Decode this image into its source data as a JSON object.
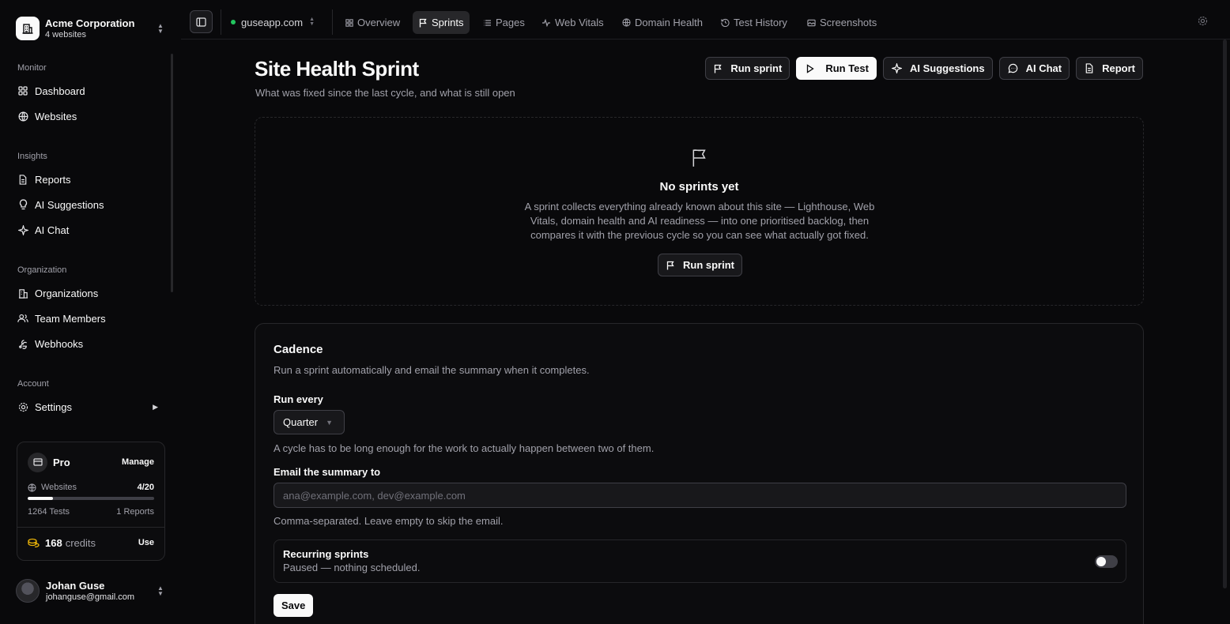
{
  "org": {
    "name": "Acme Corporation",
    "subtitle": "4 websites"
  },
  "sidebar": {
    "groups": [
      {
        "title": "Monitor",
        "items": [
          {
            "label": "Dashboard",
            "icon": "grid-icon"
          },
          {
            "label": "Websites",
            "icon": "globe-icon"
          }
        ]
      },
      {
        "title": "Insights",
        "items": [
          {
            "label": "Reports",
            "icon": "file-icon"
          },
          {
            "label": "AI Suggestions",
            "icon": "lightbulb-icon"
          },
          {
            "label": "AI Chat",
            "icon": "sparkles-icon"
          }
        ]
      },
      {
        "title": "Organization",
        "items": [
          {
            "label": "Organizations",
            "icon": "building-icon"
          },
          {
            "label": "Team Members",
            "icon": "users-icon"
          },
          {
            "label": "Webhooks",
            "icon": "webhook-icon"
          }
        ]
      },
      {
        "title": "Account",
        "items": [
          {
            "label": "Settings",
            "icon": "gear-icon"
          }
        ]
      }
    ]
  },
  "plan": {
    "name": "Pro",
    "manage_label": "Manage",
    "websites_label": "Websites",
    "websites_value": "4/20",
    "websites_fraction": 0.2,
    "tests": "1264 Tests",
    "reports": "1 Reports",
    "credits_value": "168",
    "credits_label": "credits",
    "use_label": "Use"
  },
  "user": {
    "name": "Johan Guse",
    "email": "johanguse@gmail.com"
  },
  "topbar": {
    "site": "guseapp.com",
    "tabs": [
      {
        "label": "Overview",
        "icon": "grid-icon"
      },
      {
        "label": "Sprints",
        "icon": "flag-icon",
        "active": true
      },
      {
        "label": "Pages",
        "icon": "list-icon"
      },
      {
        "label": "Web Vitals",
        "icon": "activity-icon"
      },
      {
        "label": "Domain Health",
        "icon": "globe-icon"
      },
      {
        "label": "Test History",
        "icon": "history-icon"
      },
      {
        "label": "Screenshots",
        "icon": "image-icon"
      }
    ]
  },
  "page": {
    "title": "Site Health Sprint",
    "subtitle": "What was fixed since the last cycle, and what is still open",
    "actions": {
      "run_sprint": "Run sprint",
      "run_test": "Run Test",
      "ai_suggestions": "AI Suggestions",
      "ai_chat": "AI Chat",
      "report": "Report"
    }
  },
  "empty": {
    "title": "No sprints yet",
    "description": "A sprint collects everything already known about this site — Lighthouse, Web Vitals, domain health and AI readiness — into one prioritised backlog, then compares it with the previous cycle so you can see what actually got fixed.",
    "button": "Run sprint"
  },
  "cadence": {
    "title": "Cadence",
    "subtitle": "Run a sprint automatically and email the summary when it completes.",
    "run_every_label": "Run every",
    "run_every_value": "Quarter",
    "run_every_help": "A cycle has to be long enough for the work to actually happen between two of them.",
    "email_label": "Email the summary to",
    "email_placeholder": "ana@example.com, dev@example.com",
    "email_value": "",
    "email_help": "Comma-separated. Leave empty to skip the email.",
    "recurring_title": "Recurring sprints",
    "recurring_status": "Paused — nothing scheduled.",
    "save_label": "Save"
  }
}
